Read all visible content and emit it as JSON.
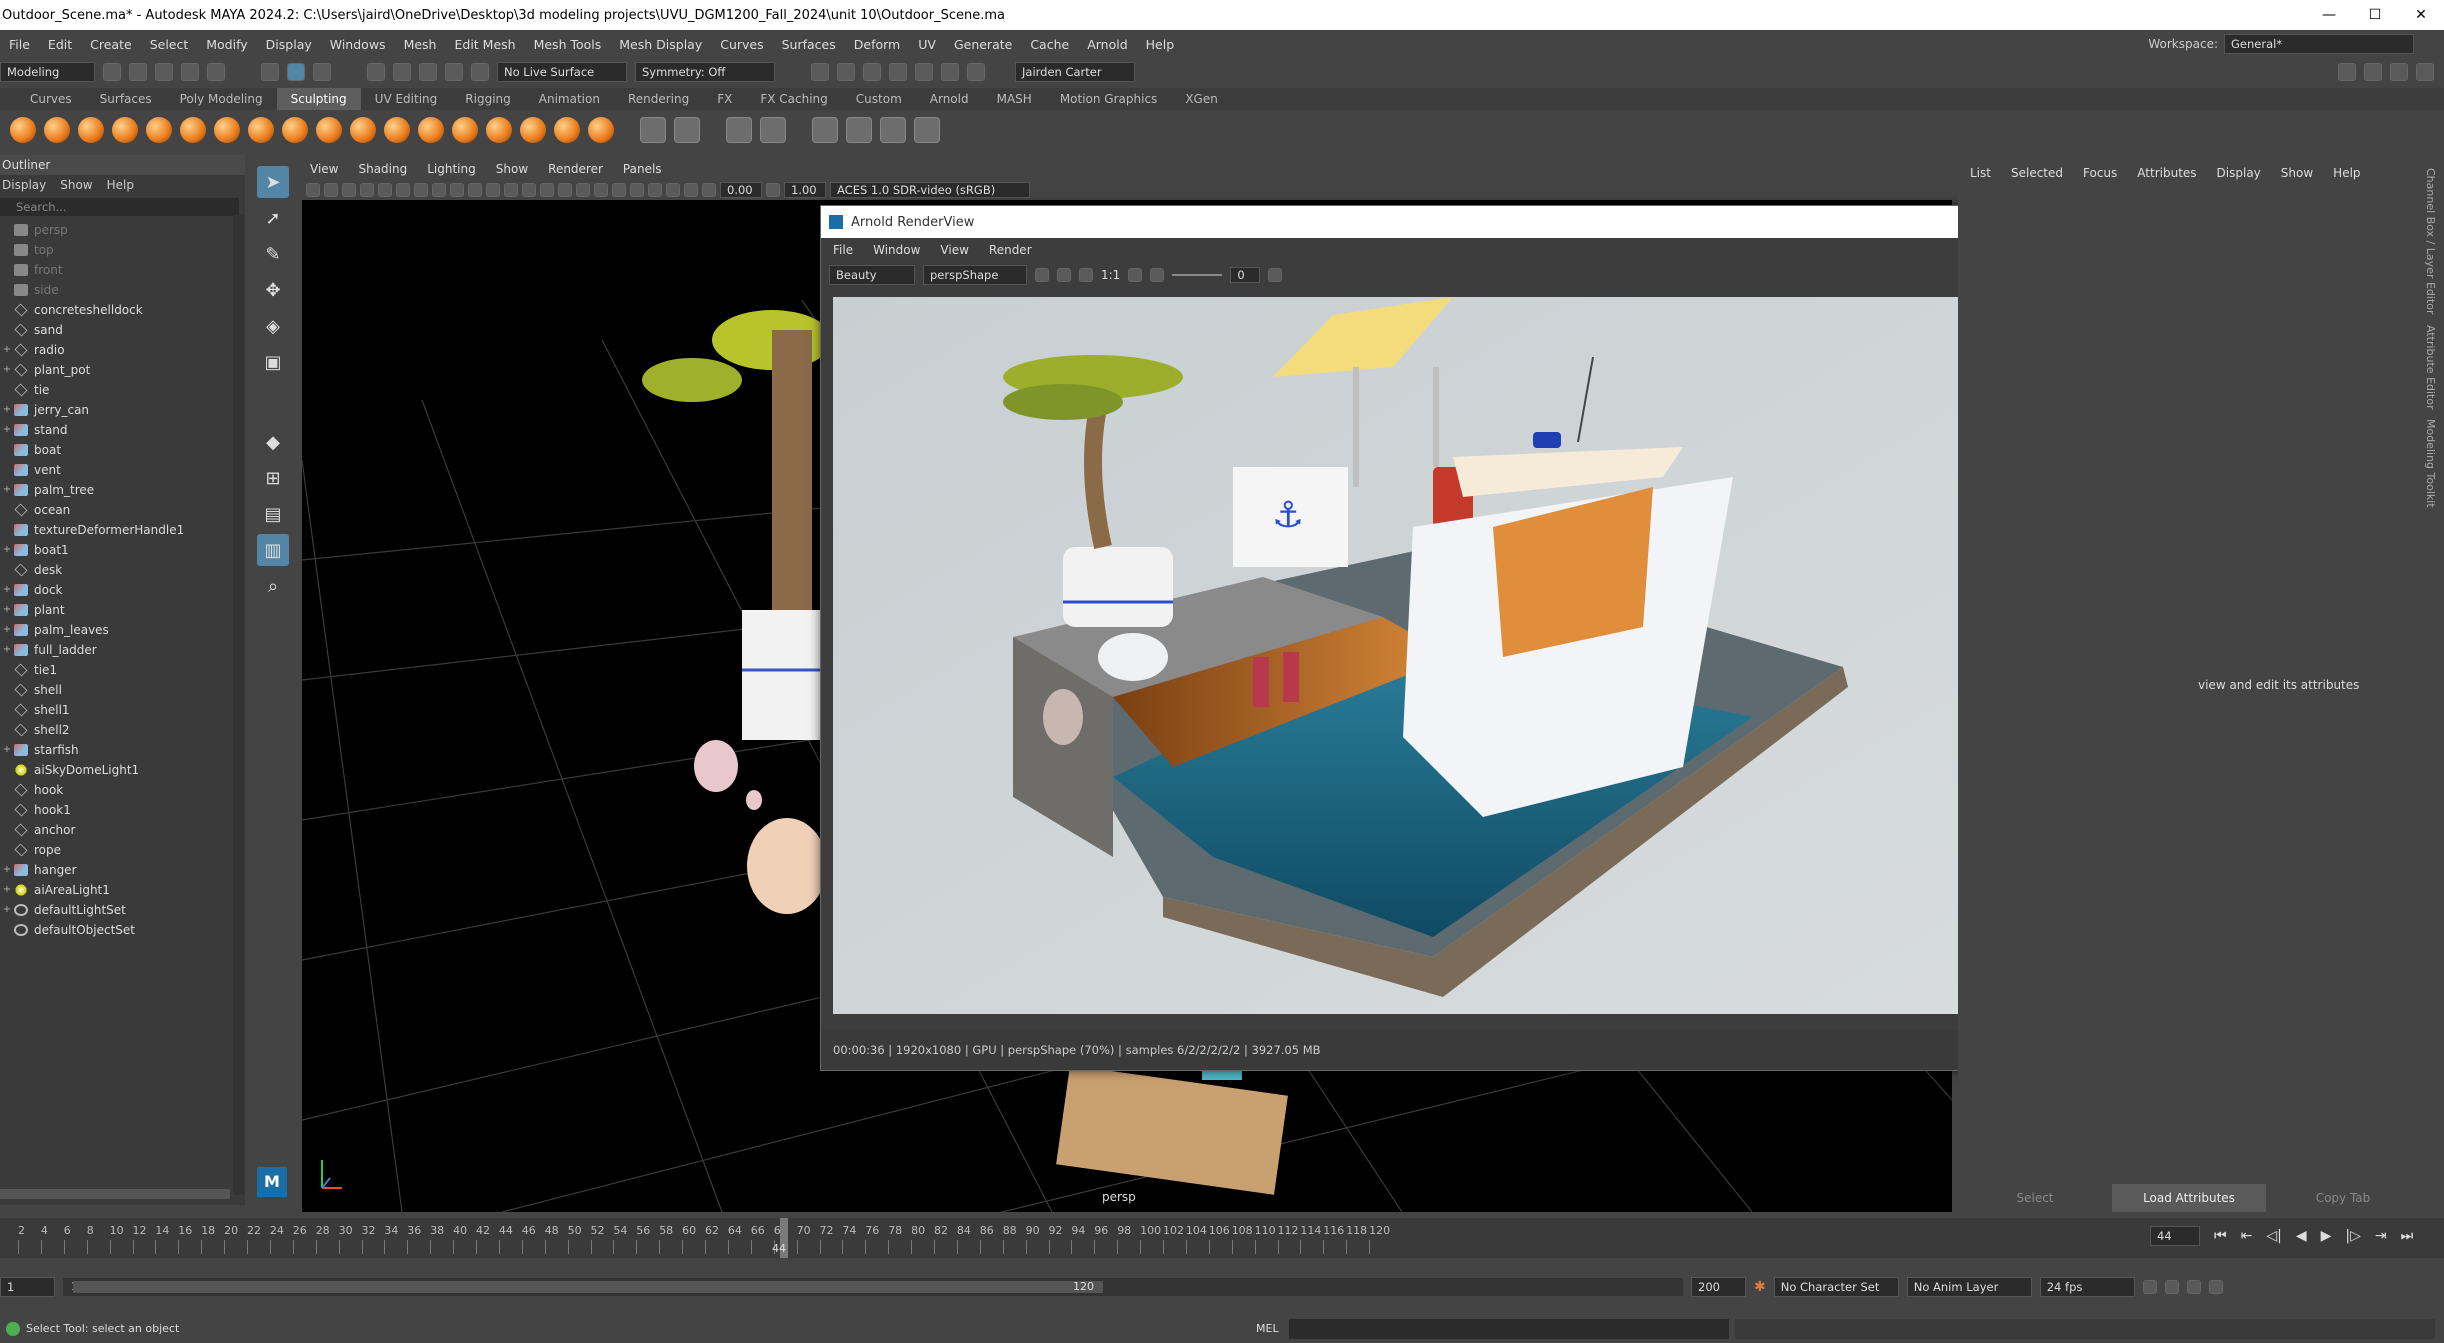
{
  "window": {
    "title": "Outdoor_Scene.ma* - Autodesk MAYA 2024.2: C:\\Users\\jaird\\OneDrive\\Desktop\\3d modeling projects\\UVU_DGM1200_Fall_2024\\unit 10\\Outdoor_Scene.ma",
    "minimize": "—",
    "maximize": "☐",
    "close": "✕"
  },
  "menubar": {
    "items": [
      "File",
      "Edit",
      "Create",
      "Select",
      "Modify",
      "Display",
      "Windows",
      "Mesh",
      "Edit Mesh",
      "Mesh Tools",
      "Mesh Display",
      "Curves",
      "Surfaces",
      "Deform",
      "UV",
      "Generate",
      "Cache",
      "Arnold",
      "Help"
    ],
    "workspace_label": "Workspace:",
    "workspace_value": "General*"
  },
  "statusline": {
    "mode": "Modeling",
    "live_surface": "No Live Surface",
    "symmetry": "Symmetry: Off",
    "user": "Jairden Carter"
  },
  "shelf": {
    "tabs": [
      "Curves",
      "Surfaces",
      "Poly Modeling",
      "Sculpting",
      "UV Editing",
      "Rigging",
      "Animation",
      "Rendering",
      "FX",
      "FX Caching",
      "Custom",
      "Arnold",
      "MASH",
      "Motion Graphics",
      "XGen"
    ],
    "active_tab": "Sculpting"
  },
  "outliner": {
    "title": "Outliner",
    "menu": [
      "Display",
      "Show",
      "Help"
    ],
    "search_placeholder": "Search...",
    "items": [
      {
        "label": "persp",
        "icon": "camera-icon",
        "dim": true,
        "expand": ""
      },
      {
        "label": "top",
        "icon": "camera-icon",
        "dim": true,
        "expand": ""
      },
      {
        "label": "front",
        "icon": "camera-icon",
        "dim": true,
        "expand": ""
      },
      {
        "label": "side",
        "icon": "camera-icon",
        "dim": true,
        "expand": ""
      },
      {
        "label": "concreteshelldock",
        "icon": "group-icon",
        "dim": false,
        "expand": ""
      },
      {
        "label": "sand",
        "icon": "group-icon",
        "dim": false,
        "expand": ""
      },
      {
        "label": "radio",
        "icon": "group-icon",
        "dim": false,
        "expand": "+"
      },
      {
        "label": "plant_pot",
        "icon": "group-icon",
        "dim": false,
        "expand": "+"
      },
      {
        "label": "tie",
        "icon": "group-icon",
        "dim": false,
        "expand": ""
      },
      {
        "label": "jerry_can",
        "icon": "mesh-icon",
        "dim": false,
        "expand": "+"
      },
      {
        "label": "stand",
        "icon": "mesh-icon",
        "dim": false,
        "expand": "+"
      },
      {
        "label": "boat",
        "icon": "mesh-icon",
        "dim": false,
        "expand": ""
      },
      {
        "label": "vent",
        "icon": "mesh-icon",
        "dim": false,
        "expand": ""
      },
      {
        "label": "palm_tree",
        "icon": "mesh-icon",
        "dim": false,
        "expand": "+"
      },
      {
        "label": "ocean",
        "icon": "group-icon",
        "dim": false,
        "expand": ""
      },
      {
        "label": "textureDeformerHandle1",
        "icon": "mesh-icon",
        "dim": false,
        "expand": ""
      },
      {
        "label": "boat1",
        "icon": "mesh-icon",
        "dim": false,
        "expand": "+"
      },
      {
        "label": "desk",
        "icon": "group-icon",
        "dim": false,
        "expand": ""
      },
      {
        "label": "dock",
        "icon": "mesh-icon",
        "dim": false,
        "expand": "+"
      },
      {
        "label": "plant",
        "icon": "mesh-icon",
        "dim": false,
        "expand": "+"
      },
      {
        "label": "palm_leaves",
        "icon": "mesh-icon",
        "dim": false,
        "expand": "+"
      },
      {
        "label": "full_ladder",
        "icon": "mesh-icon",
        "dim": false,
        "expand": "+"
      },
      {
        "label": "tie1",
        "icon": "group-icon",
        "dim": false,
        "expand": ""
      },
      {
        "label": "shell",
        "icon": "group-icon",
        "dim": false,
        "expand": ""
      },
      {
        "label": "shell1",
        "icon": "group-icon",
        "dim": false,
        "expand": ""
      },
      {
        "label": "shell2",
        "icon": "group-icon",
        "dim": false,
        "expand": ""
      },
      {
        "label": "starfish",
        "icon": "mesh-icon",
        "dim": false,
        "expand": "+"
      },
      {
        "label": "aiSkyDomeLight1",
        "icon": "light-icon",
        "dim": false,
        "expand": ""
      },
      {
        "label": "hook",
        "icon": "group-icon",
        "dim": false,
        "expand": ""
      },
      {
        "label": "hook1",
        "icon": "group-icon",
        "dim": false,
        "expand": ""
      },
      {
        "label": "anchor",
        "icon": "group-icon",
        "dim": false,
        "expand": ""
      },
      {
        "label": "rope",
        "icon": "group-icon",
        "dim": false,
        "expand": ""
      },
      {
        "label": "hanger",
        "icon": "mesh-icon",
        "dim": false,
        "expand": "+"
      },
      {
        "label": "aiAreaLight1",
        "icon": "light-icon",
        "dim": false,
        "expand": "+"
      },
      {
        "label": "defaultLightSet",
        "icon": "set-icon",
        "dim": false,
        "expand": "+"
      },
      {
        "label": "defaultObjectSet",
        "icon": "set-icon",
        "dim": false,
        "expand": ""
      }
    ]
  },
  "viewport": {
    "menu": [
      "View",
      "Shading",
      "Lighting",
      "Show",
      "Renderer",
      "Panels"
    ],
    "exposure": "0.00",
    "gamma": "1.00",
    "colorspace": "ACES 1.0 SDR-video (sRGB)",
    "camera_label": "persp"
  },
  "renderview": {
    "title": "Arnold RenderView",
    "menu": [
      "File",
      "Window",
      "View",
      "Render"
    ],
    "aov": "Beauty",
    "camera": "perspShape",
    "ratio": "1:1",
    "frame_field": "0",
    "status": "00:00:36 | 1920x1080 | GPU | perspShape (70%) | samples 6/2/2/2/2/2 | 3927.05 MB"
  },
  "rightpanel": {
    "menu": [
      "List",
      "Selected",
      "Focus",
      "Attributes",
      "Display",
      "Show",
      "Help"
    ],
    "hint": "view and edit its attributes",
    "buttons": [
      "Select",
      "Load Attributes",
      "Copy Tab"
    ],
    "side_tabs": [
      "Channel Box / Layer Editor",
      "Attribute Editor",
      "Modeling Toolkit"
    ]
  },
  "timeline": {
    "ticks": [
      "2",
      "4",
      "6",
      "8",
      "10",
      "12",
      "14",
      "16",
      "18",
      "20",
      "22",
      "24",
      "26",
      "28",
      "30",
      "32",
      "34",
      "36",
      "38",
      "40",
      "42",
      "44",
      "46",
      "48",
      "50",
      "52",
      "54",
      "56",
      "58",
      "60",
      "62",
      "64",
      "66",
      "68",
      "70",
      "72",
      "74",
      "76",
      "78",
      "80",
      "82",
      "84",
      "86",
      "88",
      "90",
      "92",
      "94",
      "96",
      "98",
      "100",
      "102",
      "104",
      "106",
      "108",
      "110",
      "112",
      "114",
      "116",
      "118",
      "120"
    ],
    "current_frame": "44",
    "current_frame_field": "44"
  },
  "range": {
    "start": "1",
    "inner_start": "1",
    "inner_end": "120",
    "end": "200",
    "character_set": "No Character Set",
    "anim_layer": "No Anim Layer",
    "fps": "24 fps"
  },
  "cmdline": {
    "help": "Select Tool: select an object",
    "lang": "MEL"
  }
}
